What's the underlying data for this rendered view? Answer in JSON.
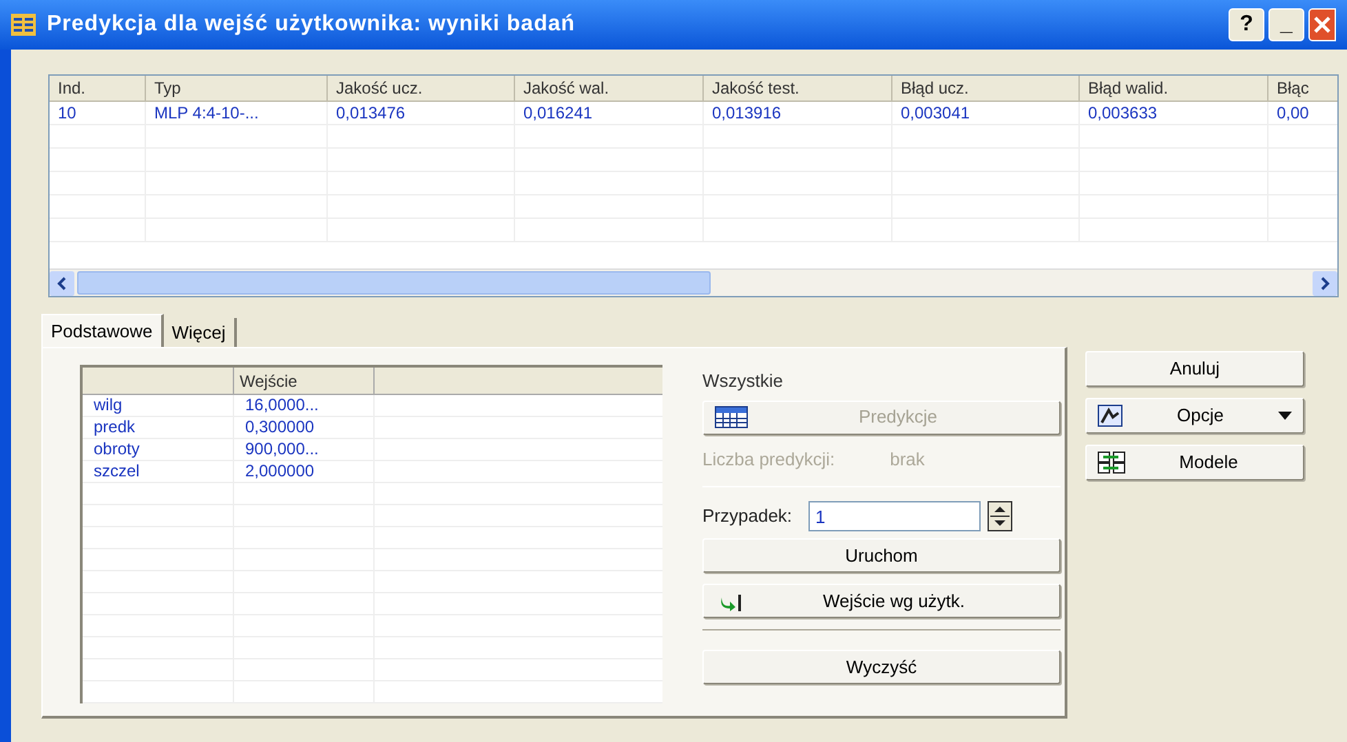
{
  "window": {
    "title": "Predykcja dla wejść użytkownika: wyniki badań",
    "controls": [
      "?",
      "_"
    ]
  },
  "results_table": {
    "columns": [
      "Ind.",
      "Typ",
      "Jakość ucz.",
      "Jakość wal.",
      "Jakość test.",
      "Błąd ucz.",
      "Błąd walid.",
      "Błąc"
    ],
    "rows": [
      [
        "10",
        "MLP 4:4-10-...",
        "0,013476",
        "0,016241",
        "0,013916",
        "0,003041",
        "0,003633",
        "0,00"
      ]
    ]
  },
  "tabs": [
    {
      "label": "Podstawowe",
      "selected": true
    },
    {
      "label": "Więcej",
      "selected": false
    }
  ],
  "inputs_table": {
    "columns": [
      "",
      "Wejście"
    ],
    "rows": [
      [
        "wilg",
        "16,0000..."
      ],
      [
        "predk",
        "0,300000"
      ],
      [
        "obroty",
        "900,000..."
      ],
      [
        "szczel",
        "2,000000"
      ]
    ]
  },
  "prediction": {
    "group_label": "Wszystkie",
    "predict_button": {
      "label": "Predykcje",
      "disabled": true
    },
    "count_label": "Liczba predykcji:",
    "count_value": "brak",
    "count_disabled": true,
    "case_label": "Przypadek:",
    "case_value": "1",
    "run_button": "Uruchom",
    "user_input_button": "Wejście wg użytk.",
    "clear_button": "Wyczyść"
  },
  "side_buttons": [
    {
      "label": "Anuluj",
      "kind": "plain"
    },
    {
      "label": "Opcje",
      "kind": "menu"
    },
    {
      "label": "Modele",
      "kind": "models"
    }
  ]
}
